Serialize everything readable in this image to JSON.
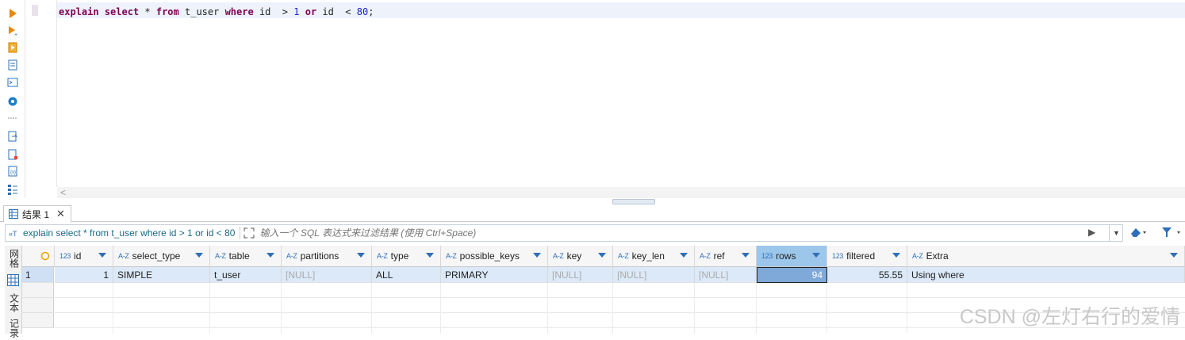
{
  "editor": {
    "sql_tokens": [
      {
        "t": "explain",
        "c": "kw"
      },
      {
        "t": " ",
        "c": ""
      },
      {
        "t": "select",
        "c": "kw"
      },
      {
        "t": " * ",
        "c": ""
      },
      {
        "t": "from",
        "c": "kw"
      },
      {
        "t": " t_user ",
        "c": ""
      },
      {
        "t": "where",
        "c": "kw"
      },
      {
        "t": " id  > ",
        "c": ""
      },
      {
        "t": "1",
        "c": "num"
      },
      {
        "t": " ",
        "c": ""
      },
      {
        "t": "or",
        "c": "kw"
      },
      {
        "t": " id  < ",
        "c": ""
      },
      {
        "t": "80",
        "c": "num"
      },
      {
        "t": ";",
        "c": ""
      }
    ],
    "scroll_left_glyph": "<"
  },
  "toolbar": {
    "icons": [
      "run-statement-icon",
      "run-script-icon",
      "explain-plan-icon",
      "load-plan-icon",
      "console-icon",
      "settings-icon",
      "more-icon",
      "export-icon",
      "new-file-icon",
      "format-icon",
      "outline-icon"
    ]
  },
  "results": {
    "tab_label": "结果 1",
    "filter_query": "explain select * from t_user where id > 1 or id < 80",
    "filter_placeholder": "输入一个 SQL 表达式来过滤结果 (使用 Ctrl+Space)",
    "side_tabs": [
      "网格",
      "文本",
      "记录"
    ],
    "columns": [
      {
        "type": "123",
        "name": "id"
      },
      {
        "type": "A-Z",
        "name": "select_type"
      },
      {
        "type": "A-Z",
        "name": "table"
      },
      {
        "type": "A-Z",
        "name": "partitions"
      },
      {
        "type": "A-Z",
        "name": "type"
      },
      {
        "type": "A-Z",
        "name": "possible_keys"
      },
      {
        "type": "A-Z",
        "name": "key"
      },
      {
        "type": "A-Z",
        "name": "key_len"
      },
      {
        "type": "A-Z",
        "name": "ref"
      },
      {
        "type": "123",
        "name": "rows"
      },
      {
        "type": "123",
        "name": "filtered"
      },
      {
        "type": "A-Z",
        "name": "Extra"
      }
    ],
    "rows": [
      {
        "num": "1",
        "cells": [
          "1",
          "SIMPLE",
          "t_user",
          "[NULL]",
          "ALL",
          "PRIMARY",
          "[NULL]",
          "[NULL]",
          "[NULL]",
          "94",
          "55.55",
          "Using where"
        ]
      }
    ]
  },
  "watermark": "CSDN @左灯右行的爱情",
  "colors": {
    "keyword": "#7f0055",
    "number": "#1b22cc",
    "row_selected": "#dce9f8",
    "header_selected": "#9cc6ea",
    "accent": "#2e6fb7"
  }
}
